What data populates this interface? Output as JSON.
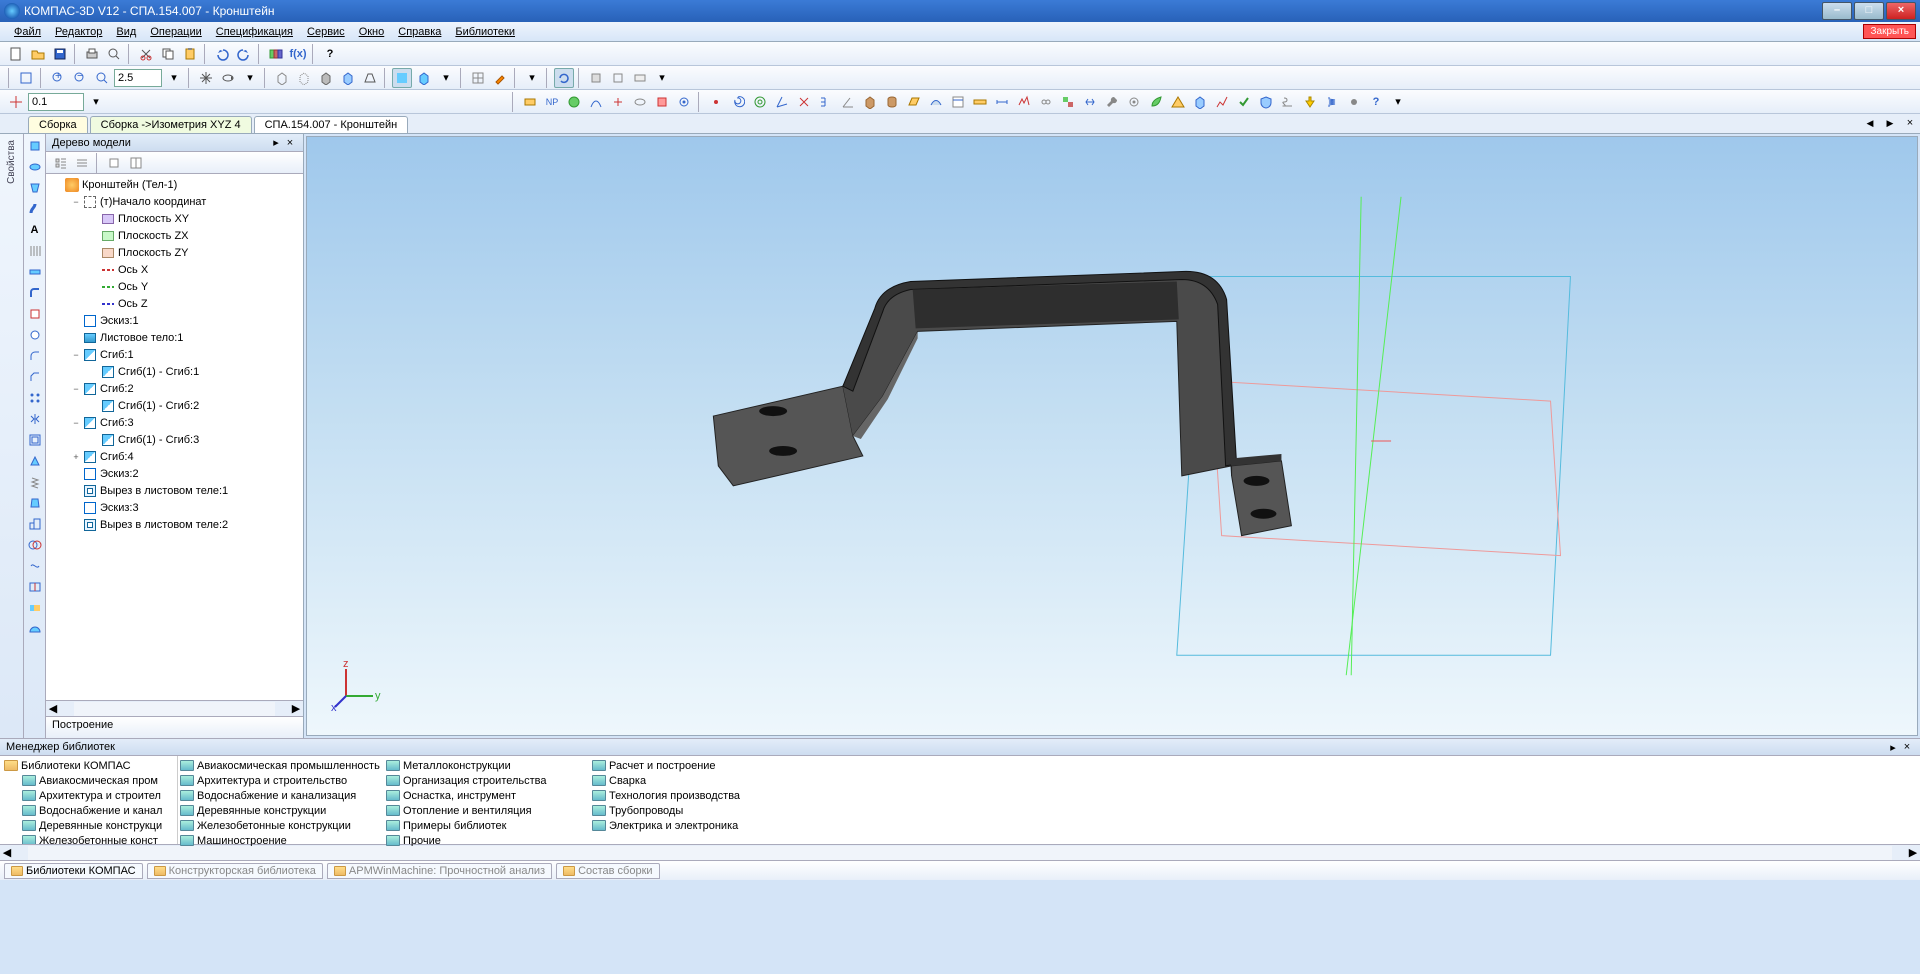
{
  "window": {
    "title": "КОМПАС-3D V12 - СПА.154.007 - Кронштейн",
    "close_label": "Закрыть"
  },
  "menu": [
    "Файл",
    "Редактор",
    "Вид",
    "Операции",
    "Спецификация",
    "Сервис",
    "Окно",
    "Справка",
    "Библиотеки"
  ],
  "toolbar2": {
    "zoom_value": "2.5"
  },
  "toolbar3": {
    "step_value": "0.1"
  },
  "tabs": [
    {
      "label": "Сборка",
      "kind": "yellow"
    },
    {
      "label": "Сборка ->Изометрия XYZ 4",
      "kind": "green"
    },
    {
      "label": "СПА.154.007 - Кронштейн",
      "kind": "active"
    }
  ],
  "side_label": "Свойства",
  "tree": {
    "title": "Дерево модели",
    "status": "Построение",
    "nodes": [
      {
        "depth": 0,
        "toggle": "",
        "icon": "root",
        "label": "Кронштейн (Тел-1)"
      },
      {
        "depth": 1,
        "toggle": "−",
        "icon": "origin",
        "label": "(т)Начало координат"
      },
      {
        "depth": 2,
        "toggle": "",
        "icon": "planexy",
        "label": "Плоскость XY"
      },
      {
        "depth": 2,
        "toggle": "",
        "icon": "planezx",
        "label": "Плоскость ZX"
      },
      {
        "depth": 2,
        "toggle": "",
        "icon": "planezy",
        "label": "Плоскость ZY"
      },
      {
        "depth": 2,
        "toggle": "",
        "icon": "axisx",
        "label": "Ось X"
      },
      {
        "depth": 2,
        "toggle": "",
        "icon": "axisy",
        "label": "Ось Y"
      },
      {
        "depth": 2,
        "toggle": "",
        "icon": "axisz",
        "label": "Ось Z"
      },
      {
        "depth": 1,
        "toggle": "",
        "icon": "sketch",
        "label": "Эскиз:1"
      },
      {
        "depth": 1,
        "toggle": "",
        "icon": "sheet",
        "label": "Листовое тело:1"
      },
      {
        "depth": 1,
        "toggle": "−",
        "icon": "bend",
        "label": "Сгиб:1"
      },
      {
        "depth": 2,
        "toggle": "",
        "icon": "bend",
        "label": "Сгиб(1) - Сгиб:1"
      },
      {
        "depth": 1,
        "toggle": "−",
        "icon": "bend",
        "label": "Сгиб:2"
      },
      {
        "depth": 2,
        "toggle": "",
        "icon": "bend",
        "label": "Сгиб(1) - Сгиб:2"
      },
      {
        "depth": 1,
        "toggle": "−",
        "icon": "bend",
        "label": "Сгиб:3"
      },
      {
        "depth": 2,
        "toggle": "",
        "icon": "bend",
        "label": "Сгиб(1) - Сгиб:3"
      },
      {
        "depth": 1,
        "toggle": "+",
        "icon": "bend",
        "label": "Сгиб:4"
      },
      {
        "depth": 1,
        "toggle": "",
        "icon": "sketch",
        "label": "Эскиз:2"
      },
      {
        "depth": 1,
        "toggle": "",
        "icon": "cut",
        "label": "Вырез в листовом теле:1"
      },
      {
        "depth": 1,
        "toggle": "",
        "icon": "sketch",
        "label": "Эскиз:3"
      },
      {
        "depth": 1,
        "toggle": "",
        "icon": "cut",
        "label": "Вырез в листовом теле:2"
      }
    ]
  },
  "lib": {
    "title": "Менеджер библиотек",
    "tree": [
      "Библиотеки КОМПАС",
      "Авиакосмическая пром",
      "Архитектура и строител",
      "Водоснабжение и канал",
      "Деревянные конструкци",
      "Железобетонные конст"
    ],
    "cols": [
      [
        "Авиакосмическая промышленность",
        "Архитектура и строительство",
        "Водоснабжение и канализация",
        "Деревянные конструкции",
        "Железобетонные конструкции",
        "Машиностроение"
      ],
      [
        "Металлоконструкции",
        "Организация строительства",
        "Оснастка, инструмент",
        "Отопление и вентиляция",
        "Примеры библиотек",
        "Прочие"
      ],
      [
        "Расчет и построение",
        "Сварка",
        "Технология производства",
        "Трубопроводы",
        "Электрика и электроника"
      ]
    ]
  },
  "footer_tabs": [
    {
      "label": "Библиотеки КОМПАС",
      "active": true
    },
    {
      "label": "Конструкторская библиотека",
      "active": false
    },
    {
      "label": "APMWinMachine: Прочностной анализ",
      "active": false
    },
    {
      "label": "Состав сборки",
      "active": false
    }
  ]
}
